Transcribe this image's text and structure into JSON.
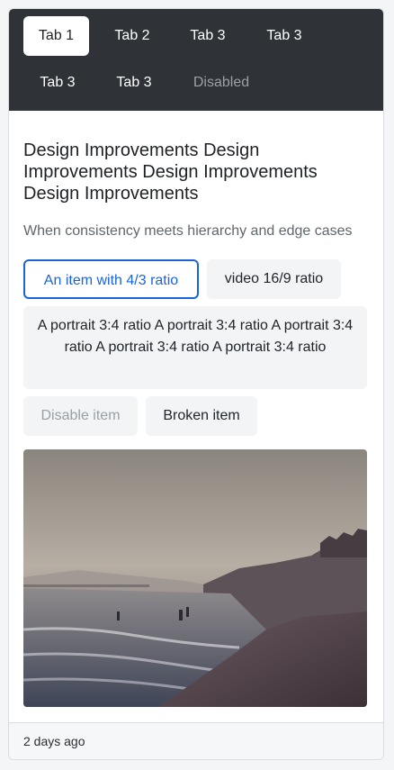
{
  "tabs": [
    {
      "label": "Tab 1",
      "active": true
    },
    {
      "label": "Tab 2"
    },
    {
      "label": "Tab 3"
    },
    {
      "label": "Tab 3"
    },
    {
      "label": "Tab 3"
    },
    {
      "label": "Tab 3"
    },
    {
      "label": "Disabled",
      "disabled": true
    }
  ],
  "card": {
    "title": "Design Improvements Design Improvements Design Improvements Design Improvements",
    "subtitle": "When consistency meets hierarchy and edge cases"
  },
  "items": [
    {
      "label": "An item with 4/3 ratio",
      "state": "selected"
    },
    {
      "label": "video 16/9 ratio",
      "state": "default"
    },
    {
      "label": "A portrait 3:4 ratio A portrait 3:4 ratio A portrait 3:4 ratio A portrait 3:4 ratio A portrait 3:4 ratio",
      "state": "default"
    },
    {
      "label": "Disable item",
      "state": "disabled"
    },
    {
      "label": "Broken item",
      "state": "default"
    }
  ],
  "image": {
    "description_icon": "beach-photo"
  },
  "footer": {
    "timestamp": "2 days ago"
  },
  "colors": {
    "tabbar": "#2f3337",
    "accent": "#1a63d9",
    "chip": "#f3f4f6"
  }
}
